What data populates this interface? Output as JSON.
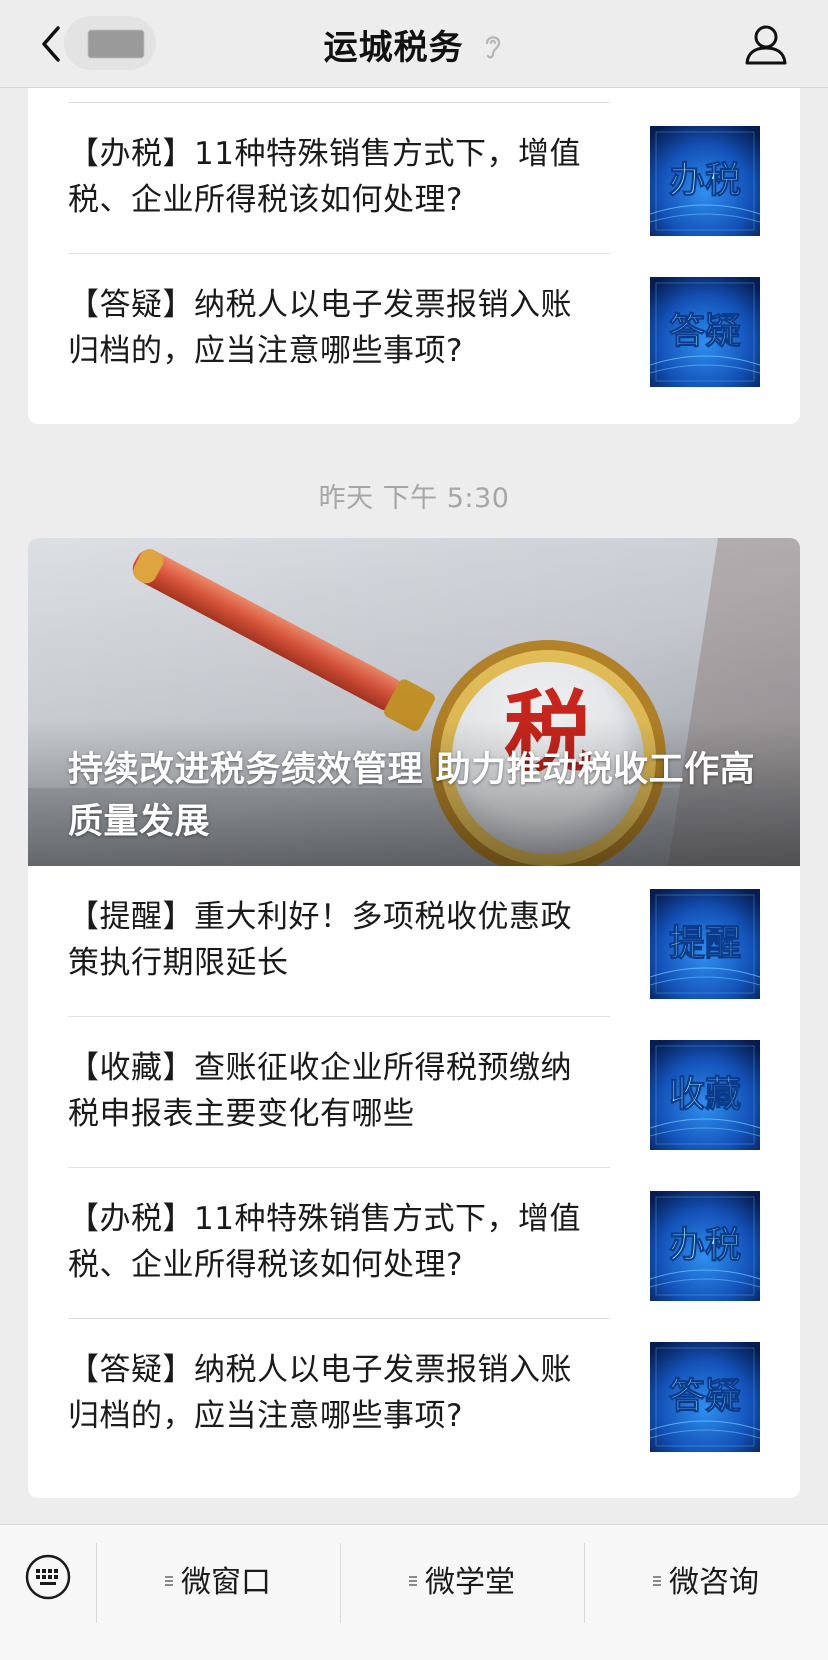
{
  "header": {
    "title": "运城税务",
    "back_icon": "chevron-left-icon",
    "listen_icon": "ear-icon",
    "profile_icon": "user-icon"
  },
  "feed": {
    "card1": {
      "items": [
        {
          "text": "【办税】11种特殊销售方式下，增值税、企业所得税该如何处理?",
          "thumb_label": "办税"
        },
        {
          "text": "【答疑】纳税人以电子发票报销入账归档的，应当注意哪些事项?",
          "thumb_label": "答疑"
        }
      ]
    },
    "timestamp": "昨天 下午 5:30",
    "card2": {
      "hero": {
        "title": "持续改进税务绩效管理 助力推动税收工作高质量发展",
        "image_text": "税"
      },
      "items": [
        {
          "text": "【提醒】重大利好！多项税收优惠政策执行期限延长",
          "thumb_label": "提醒"
        },
        {
          "text": "【收藏】查账征收企业所得税预缴纳税申报表主要变化有哪些",
          "thumb_label": "收藏"
        },
        {
          "text": "【办税】11种特殊销售方式下，增值税、企业所得税该如何处理?",
          "thumb_label": "办税"
        },
        {
          "text": "【答疑】纳税人以电子发票报销入账归档的，应当注意哪些事项?",
          "thumb_label": "答疑"
        }
      ]
    }
  },
  "bottom_menu": {
    "keyboard_icon": "keyboard-icon",
    "items": [
      {
        "label": "微窗口"
      },
      {
        "label": "微学堂"
      },
      {
        "label": "微咨询"
      }
    ]
  },
  "colors": {
    "thumb_bg_dark": "#0b2d6b",
    "thumb_bg_light": "#1e6fd9",
    "thumb_text": "#8fe6ff",
    "magnifier_gold": "#c9962a",
    "handle_red": "#d9533a"
  }
}
